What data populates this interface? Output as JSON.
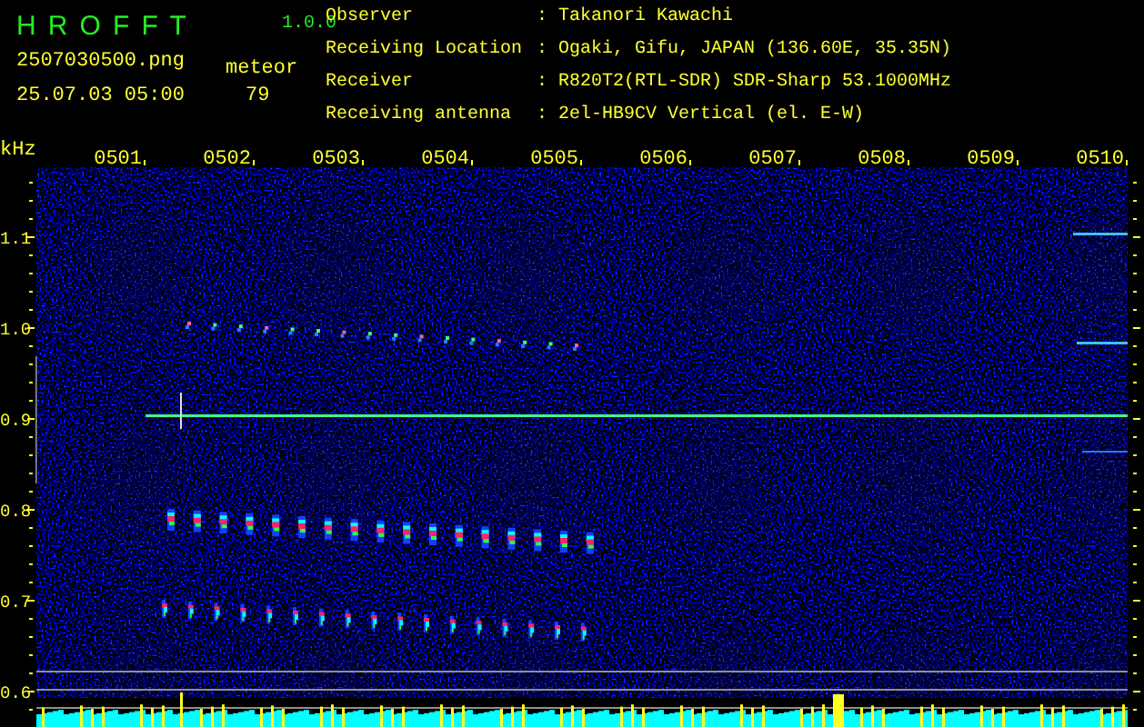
{
  "header": {
    "title": "H R O F F T",
    "version": "1.0.0",
    "file_name": "2507030500.png",
    "timestamp": "25.07.03 05:00",
    "count_label": "meteor",
    "count": "79",
    "info": [
      {
        "label": "Observer",
        "value": ": Takanori Kawachi"
      },
      {
        "label": "Receiving Location",
        "value": ": Ogaki, Gifu, JAPAN (136.60E, 35.35N)"
      },
      {
        "label": "Receiver",
        "value": ": R820T2(RTL-SDR) SDR-Sharp 53.1000MHz"
      },
      {
        "label": "Receiving antenna",
        "value": ": 2el-HB9CV Vertical (el. E-W)"
      }
    ]
  },
  "spectrogram": {
    "unit": "kHz",
    "time_labels": [
      "0501",
      "0502",
      "0503",
      "0504",
      "0505",
      "0506",
      "0507",
      "0508",
      "0509",
      "0510"
    ],
    "frequency_labels": [
      "1.1",
      "1.0",
      "0.9",
      "0.8",
      "0.7",
      "0.6"
    ]
  }
}
